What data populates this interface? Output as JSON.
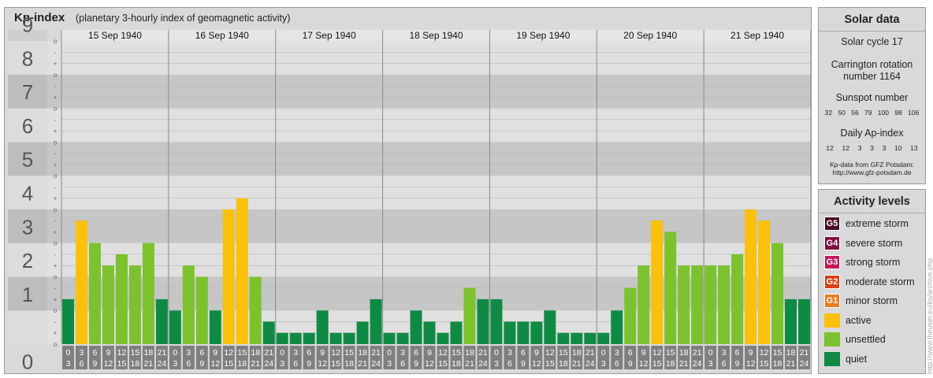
{
  "header": {
    "title": "Kp-index",
    "subtitle": "(planetary 3-hourly index of geomagnetic activity)"
  },
  "solar_data": {
    "title": "Solar data",
    "solar_cycle": "Solar cycle 17",
    "carrington_line1": "Carrington rotation",
    "carrington_line2": "number 1164",
    "sunspot_title": "Sunspot number",
    "sunspot_values": [
      "32",
      "50",
      "56",
      "79",
      "100",
      "98",
      "106"
    ],
    "ap_title": "Daily Ap-index",
    "ap_values": [
      "12",
      "12",
      "3",
      "3",
      "3",
      "10",
      "13"
    ],
    "source_line1": "Kp-data from GFZ Potsdam:",
    "source_line2": "http://www.gfz-potsdam.de"
  },
  "activity_levels": {
    "title": "Activity levels",
    "items": [
      {
        "code": "G5",
        "label": "extreme storm",
        "color": "#4a0c2a"
      },
      {
        "code": "G4",
        "label": "severe storm",
        "color": "#7e1045"
      },
      {
        "code": "G3",
        "label": "strong storm",
        "color": "#c2185b"
      },
      {
        "code": "G2",
        "label": "moderate storm",
        "color": "#d84315"
      },
      {
        "code": "G1",
        "label": "minor storm",
        "color": "#e67e22"
      },
      {
        "code": "",
        "label": "active",
        "color": "#f9c10c"
      },
      {
        "code": "",
        "label": "unsettled",
        "color": "#7cc22e"
      },
      {
        "code": "",
        "label": "quiet",
        "color": "#0f8a45"
      }
    ]
  },
  "credit": "http://www.theuser.eu/kp/archive.php",
  "colors": {
    "band_dark": "#c6c6c6",
    "band_light": "#e0e0e0",
    "quiet": "#0f8a45",
    "unsettled": "#7cc22e",
    "active": "#f9c10c",
    "label_box": "#7f7f7f"
  },
  "chart_data": {
    "type": "bar",
    "title": "Kp-index",
    "ylim": [
      0,
      9
    ],
    "yticks": [
      "0",
      "1",
      "2",
      "3",
      "4",
      "5",
      "6",
      "7",
      "8",
      "9"
    ],
    "minor_tick_marks": [
      "o",
      "+",
      "-"
    ],
    "days": [
      "15 Sep 1940",
      "16 Sep 1940",
      "17 Sep 1940",
      "18 Sep 1940",
      "19 Sep 1940",
      "20 Sep 1940",
      "21 Sep 1940"
    ],
    "interval_start": [
      "0",
      "3",
      "6",
      "9",
      "12",
      "15",
      "18",
      "21"
    ],
    "interval_end": [
      "3",
      "6",
      "9",
      "12",
      "15",
      "18",
      "21",
      "24"
    ],
    "series": [
      {
        "values": [
          1.333,
          3.667,
          3.0,
          2.333,
          2.667,
          2.333,
          3.0,
          1.333,
          1.0,
          2.333,
          2.0,
          1.0,
          4.0,
          4.333,
          2.0,
          0.667,
          0.333,
          0.333,
          0.333,
          1.0,
          0.333,
          0.333,
          0.667,
          1.333,
          0.333,
          0.333,
          1.0,
          0.667,
          0.333,
          0.667,
          1.667,
          1.333,
          1.333,
          0.667,
          0.667,
          0.667,
          1.0,
          0.333,
          0.333,
          0.333,
          0.333,
          1.0,
          1.667,
          2.333,
          3.667,
          3.333,
          2.333,
          2.333,
          2.333,
          2.333,
          2.667,
          4.0,
          3.667,
          3.0,
          1.333,
          1.333
        ]
      }
    ]
  }
}
